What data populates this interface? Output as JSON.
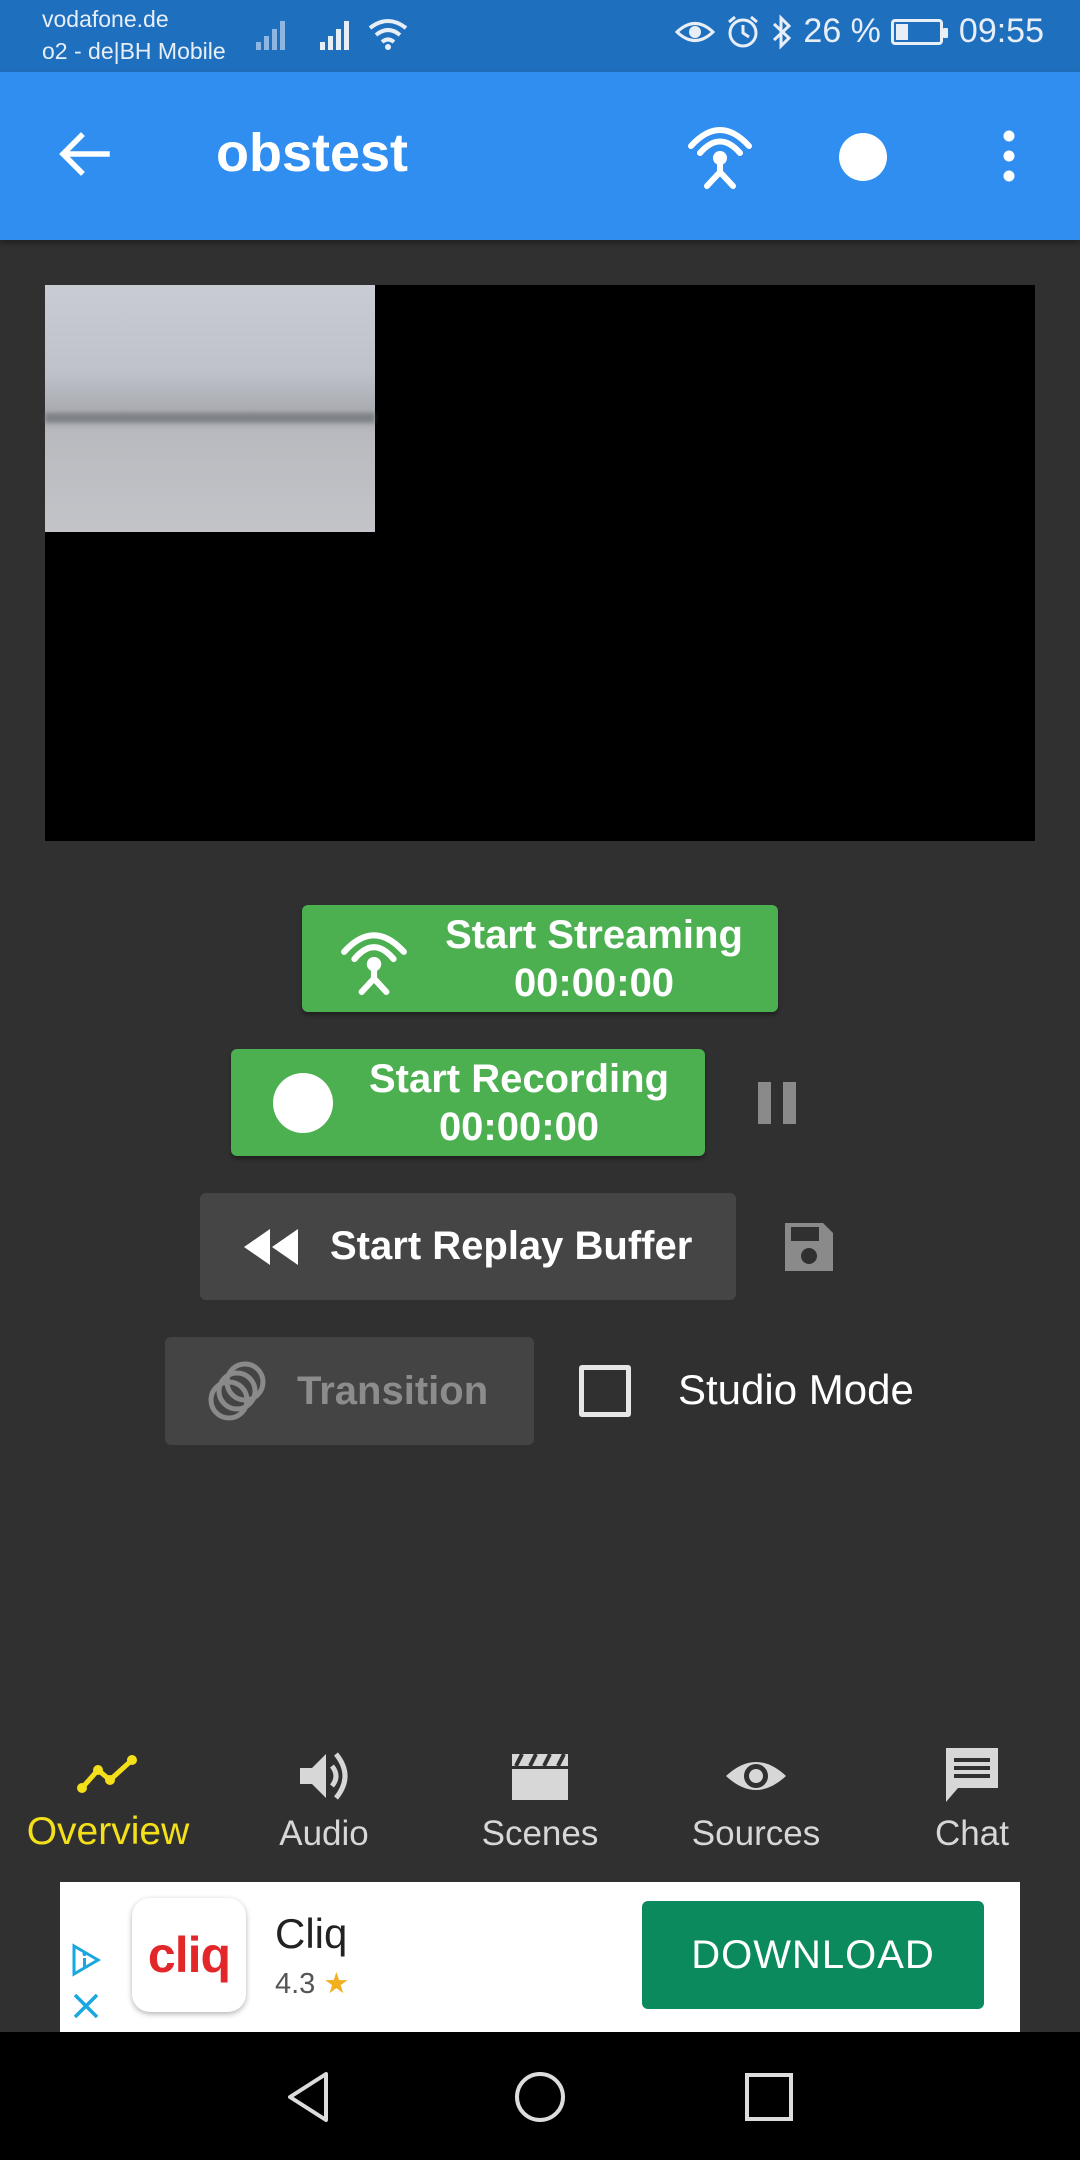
{
  "status_bar": {
    "carrier_primary": "vodafone.de",
    "carrier_secondary": "o2 - de|BH Mobile",
    "battery_percent": "26 %",
    "battery_level": 0.26,
    "time": "09:55",
    "icons": [
      "signal-icon",
      "signal-roaming-icon",
      "wifi-icon",
      "eye-icon",
      "alarm-icon",
      "bluetooth-icon",
      "battery-icon"
    ]
  },
  "app_bar": {
    "title": "obstest",
    "icons": [
      "back-arrow-icon",
      "streaming-antenna-icon",
      "record-dot-icon",
      "more-vert-icon"
    ]
  },
  "controls": {
    "stream_label": "Start Streaming",
    "stream_time": "00:00:00",
    "record_label": "Start Recording",
    "record_time": "00:00:00",
    "replay_label": "Start Replay Buffer",
    "transition_label": "Transition",
    "studio_mode_label": "Studio Mode",
    "studio_mode_checked": false
  },
  "bottom_nav": {
    "active": "Overview",
    "tabs": [
      {
        "label": "Overview",
        "icon": "trending-icon"
      },
      {
        "label": "Audio",
        "icon": "speaker-icon"
      },
      {
        "label": "Scenes",
        "icon": "clapperboard-icon"
      },
      {
        "label": "Sources",
        "icon": "eye-icon"
      },
      {
        "label": "Chat",
        "icon": "chat-icon"
      }
    ]
  },
  "ad": {
    "logo_text": "cliq",
    "app_name": "Cliq",
    "rating": "4.3",
    "cta": "DOWNLOAD"
  },
  "colors": {
    "status_bar": "#1f6fbf",
    "app_bar": "#2f8ef0",
    "background": "#303030",
    "green_button": "#4caf50",
    "active_tab": "#f4e01a",
    "download_button": "#0b8a5e"
  }
}
